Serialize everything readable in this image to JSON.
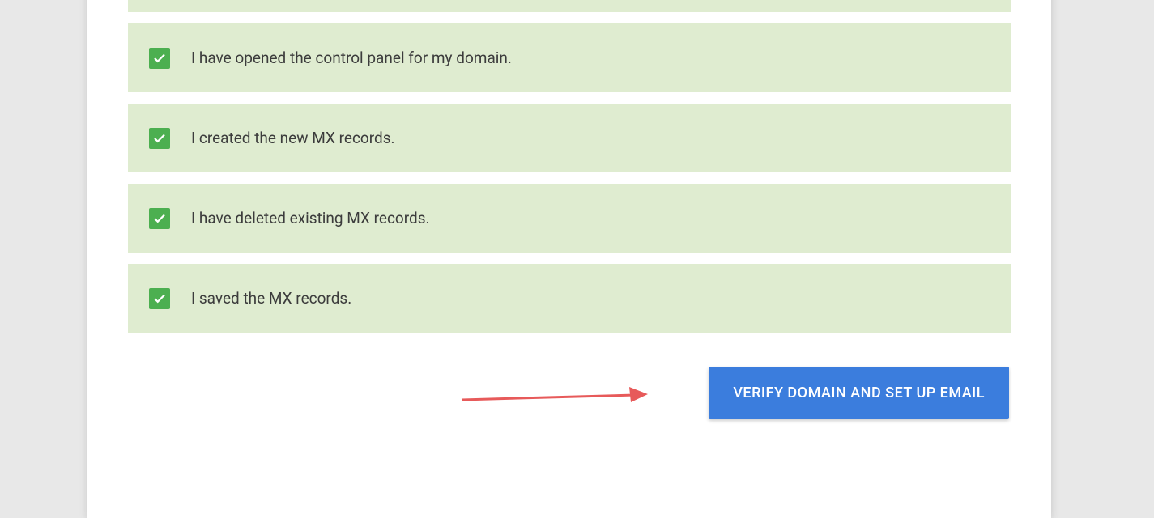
{
  "checklist": {
    "items": [
      {
        "label": "I have opened the control panel for my domain.",
        "checked": true
      },
      {
        "label": "I created the new MX records.",
        "checked": true
      },
      {
        "label": "I have deleted existing MX records.",
        "checked": true
      },
      {
        "label": "I saved the MX records.",
        "checked": true
      }
    ]
  },
  "actions": {
    "verify_label": "VERIFY DOMAIN AND SET UP EMAIL"
  },
  "colors": {
    "check_bg": "#dfecd0",
    "checkbox": "#4caf50",
    "button": "#3b7ddd",
    "annotation": "#e75a5a"
  }
}
